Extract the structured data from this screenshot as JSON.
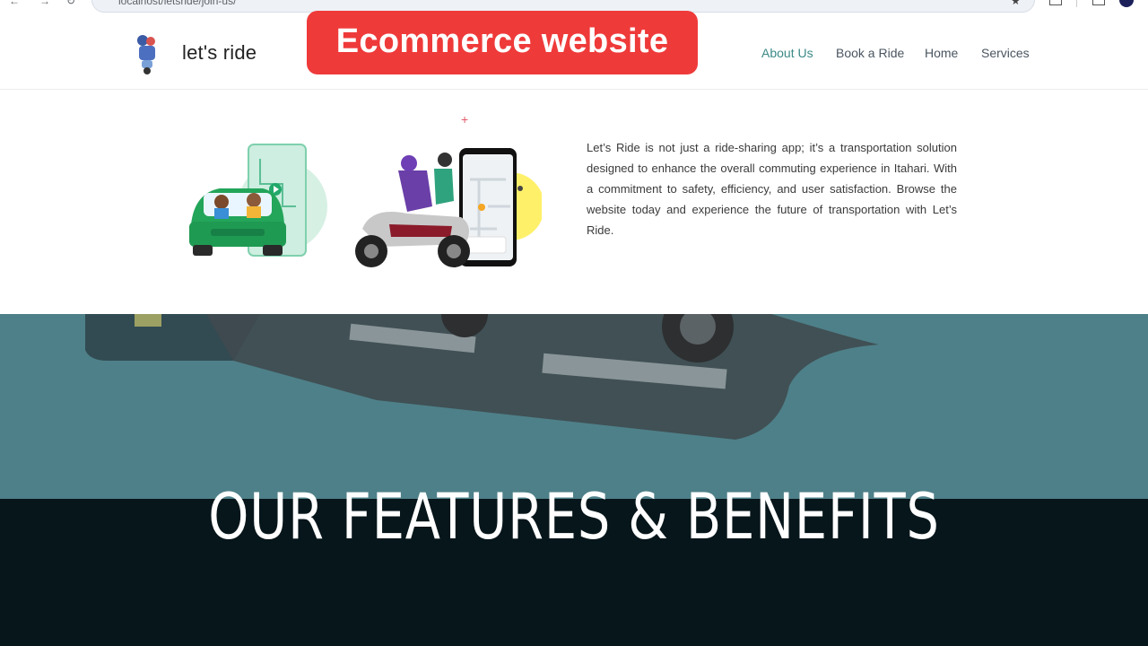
{
  "browser": {
    "url": "localhost/letsride/join-us/"
  },
  "header": {
    "brand": "let's ride",
    "nav": [
      {
        "label": "About Us",
        "active": true
      },
      {
        "label": "Book a Ride",
        "active": false
      },
      {
        "label": "Home",
        "active": false
      },
      {
        "label": "Services",
        "active": false
      }
    ]
  },
  "banner": {
    "text": "Ecommerce website"
  },
  "about": {
    "paragraph": "Let’s Ride is not just a ride-sharing app; it’s a transportation solution designed to enhance the overall commuting experience in Itahari. With a commitment to safety, efficiency, and user satisfaction.  Browse the website today and experience the future of transportation with Let’s Ride."
  },
  "hero": {
    "title": "OUR FEATURES & BENEFITS"
  },
  "colors": {
    "accent": "#3b8a86",
    "banner": "#ef3a3a",
    "hero_top": "#4e8089",
    "hero_bottom": "#07161b"
  }
}
